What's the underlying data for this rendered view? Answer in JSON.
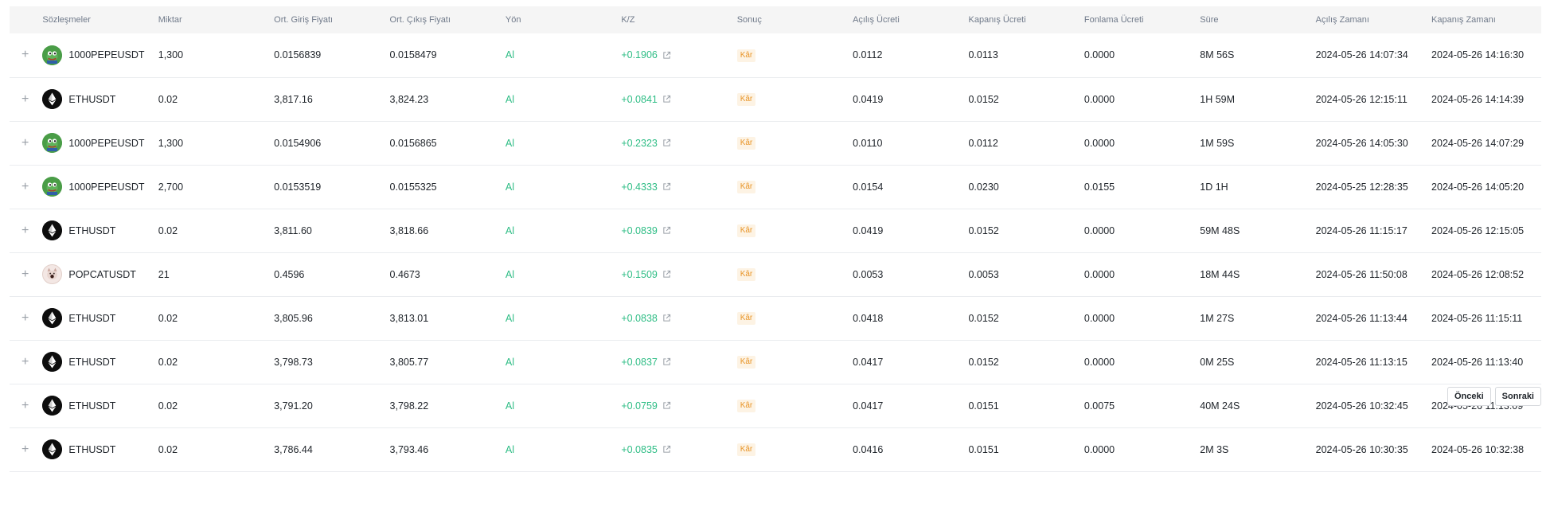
{
  "table": {
    "headers": {
      "contract": "Sözleşmeler",
      "amount": "Miktar",
      "entry_price": "Ort. Giriş Fiyatı",
      "exit_price": "Ort. Çıkış Fiyatı",
      "side": "Yön",
      "pnl": "K/Z",
      "result": "Sonuç",
      "open_fee": "Açılış Ücreti",
      "close_fee": "Kapanış Ücreti",
      "funding_fee": "Fonlama Ücreti",
      "duration": "Süre",
      "open_time": "Açılış Zamanı",
      "close_time": "Kapanış Zamanı"
    },
    "expand_symbol": "+",
    "rows": [
      {
        "icon": "pepe-icon",
        "symbol": "1000PEPEUSDT",
        "amount": "1,300",
        "entry": "0.0156839",
        "exit": "0.0158479",
        "side": "Al",
        "pnl": "+0.1906",
        "result": "Kâr",
        "open_fee": "0.0112",
        "close_fee": "0.0113",
        "funding_fee": "0.0000",
        "duration": "8M 56S",
        "open_time": "2024-05-26 14:07:34",
        "close_time": "2024-05-26 14:16:30"
      },
      {
        "icon": "eth-icon",
        "symbol": "ETHUSDT",
        "amount": "0.02",
        "entry": "3,817.16",
        "exit": "3,824.23",
        "side": "Al",
        "pnl": "+0.0841",
        "result": "Kâr",
        "open_fee": "0.0419",
        "close_fee": "0.0152",
        "funding_fee": "0.0000",
        "duration": "1H 59M",
        "open_time": "2024-05-26 12:15:11",
        "close_time": "2024-05-26 14:14:39"
      },
      {
        "icon": "pepe-icon",
        "symbol": "1000PEPEUSDT",
        "amount": "1,300",
        "entry": "0.0154906",
        "exit": "0.0156865",
        "side": "Al",
        "pnl": "+0.2323",
        "result": "Kâr",
        "open_fee": "0.0110",
        "close_fee": "0.0112",
        "funding_fee": "0.0000",
        "duration": "1M 59S",
        "open_time": "2024-05-26 14:05:30",
        "close_time": "2024-05-26 14:07:29"
      },
      {
        "icon": "pepe-icon",
        "symbol": "1000PEPEUSDT",
        "amount": "2,700",
        "entry": "0.0153519",
        "exit": "0.0155325",
        "side": "Al",
        "pnl": "+0.4333",
        "result": "Kâr",
        "open_fee": "0.0154",
        "close_fee": "0.0230",
        "funding_fee": "0.0155",
        "duration": "1D 1H",
        "open_time": "2024-05-25 12:28:35",
        "close_time": "2024-05-26 14:05:20"
      },
      {
        "icon": "eth-icon",
        "symbol": "ETHUSDT",
        "amount": "0.02",
        "entry": "3,811.60",
        "exit": "3,818.66",
        "side": "Al",
        "pnl": "+0.0839",
        "result": "Kâr",
        "open_fee": "0.0419",
        "close_fee": "0.0152",
        "funding_fee": "0.0000",
        "duration": "59M 48S",
        "open_time": "2024-05-26 11:15:17",
        "close_time": "2024-05-26 12:15:05"
      },
      {
        "icon": "popcat-icon",
        "symbol": "POPCATUSDT",
        "amount": "21",
        "entry": "0.4596",
        "exit": "0.4673",
        "side": "Al",
        "pnl": "+0.1509",
        "result": "Kâr",
        "open_fee": "0.0053",
        "close_fee": "0.0053",
        "funding_fee": "0.0000",
        "duration": "18M 44S",
        "open_time": "2024-05-26 11:50:08",
        "close_time": "2024-05-26 12:08:52"
      },
      {
        "icon": "eth-icon",
        "symbol": "ETHUSDT",
        "amount": "0.02",
        "entry": "3,805.96",
        "exit": "3,813.01",
        "side": "Al",
        "pnl": "+0.0838",
        "result": "Kâr",
        "open_fee": "0.0418",
        "close_fee": "0.0152",
        "funding_fee": "0.0000",
        "duration": "1M 27S",
        "open_time": "2024-05-26 11:13:44",
        "close_time": "2024-05-26 11:15:11"
      },
      {
        "icon": "eth-icon",
        "symbol": "ETHUSDT",
        "amount": "0.02",
        "entry": "3,798.73",
        "exit": "3,805.77",
        "side": "Al",
        "pnl": "+0.0837",
        "result": "Kâr",
        "open_fee": "0.0417",
        "close_fee": "0.0152",
        "funding_fee": "0.0000",
        "duration": "0M 25S",
        "open_time": "2024-05-26 11:13:15",
        "close_time": "2024-05-26 11:13:40"
      },
      {
        "icon": "eth-icon",
        "symbol": "ETHUSDT",
        "amount": "0.02",
        "entry": "3,791.20",
        "exit": "3,798.22",
        "side": "Al",
        "pnl": "+0.0759",
        "result": "Kâr",
        "open_fee": "0.0417",
        "close_fee": "0.0151",
        "funding_fee": "0.0075",
        "duration": "40M 24S",
        "open_time": "2024-05-26 10:32:45",
        "close_time": "2024-05-26 11:13:09"
      },
      {
        "icon": "eth-icon",
        "symbol": "ETHUSDT",
        "amount": "0.02",
        "entry": "3,786.44",
        "exit": "3,793.46",
        "side": "Al",
        "pnl": "+0.0835",
        "result": "Kâr",
        "open_fee": "0.0416",
        "close_fee": "0.0151",
        "funding_fee": "0.0000",
        "duration": "2M 3S",
        "open_time": "2024-05-26 10:30:35",
        "close_time": "2024-05-26 10:32:38"
      }
    ]
  },
  "pagination": {
    "prev_label": "Önceki",
    "next_label": "Sonraki"
  },
  "colors": {
    "positive": "#2ebd85",
    "badge_text": "#e89427",
    "badge_bg": "#fdf3e4",
    "header_bg": "#f5f5f5"
  }
}
